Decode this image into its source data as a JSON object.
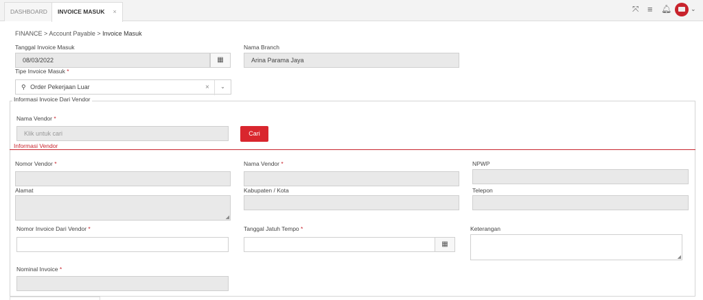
{
  "tabs": [
    {
      "label": "DASHBOARD"
    },
    {
      "label": "INVOICE MASUK",
      "close": "×"
    }
  ],
  "topbar": {
    "icons": [
      "expand-icon",
      "menu-icon",
      "bell-icon",
      "avatar",
      "chevron-down-icon"
    ]
  },
  "breadcrumb": {
    "part1": "FINANCE",
    "sep": ">",
    "part2": "Account Payable",
    "part3": "Invoice Masuk"
  },
  "form": {
    "tanggal_label": "Tanggal Invoice Masuk",
    "tanggal_value": "08/03/2022",
    "branch_label": "Nama Branch",
    "branch_value": "Arina Parama Jaya",
    "tipe_label": "Tipe Invoice Masuk",
    "tipe_value": "Order Pekerjaan Luar",
    "required_mark": "*"
  },
  "vendor_section": {
    "legend": "Informasi Invoice Dari Vendor",
    "nama_vendor_label": "Nama Vendor",
    "nama_vendor_placeholder": "Klik untuk cari",
    "cari_button": "Cari",
    "info_vendor_title": "Informasi Vendor",
    "nomor_vendor_label": "Nomor Vendor",
    "nama_vendor2_label": "Nama Vendor",
    "npwp_label": "NPWP",
    "alamat_label": "Alamat",
    "kabupaten_label": "Kabupaten / Kota",
    "telepon_label": "Telepon",
    "nomor_invoice_label": "Nomor Invoice Dari Vendor",
    "jatuh_tempo_label": "Tanggal Jatuh Tempo",
    "keterangan_label": "Keterangan",
    "nominal_label": "Nominal Invoice"
  },
  "colors": {
    "accent": "#d9262e",
    "field_bg": "#e9e9e9"
  }
}
